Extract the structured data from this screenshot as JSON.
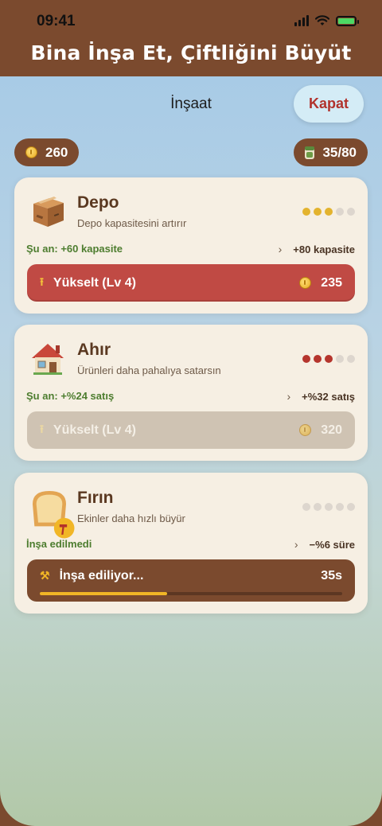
{
  "status": {
    "time": "09:41"
  },
  "app": {
    "title": "Bina İnşa Et, Çiftliğini Büyüt"
  },
  "topbar": {
    "title": "İnşaat",
    "close_label": "Kapat"
  },
  "resources": {
    "coins": "260",
    "storage": "35/80"
  },
  "buildings": [
    {
      "name": "Depo",
      "description": "Depo kapasitesini artırır",
      "current": "Şu an: +60 kapasite",
      "next": "+80 kapasite",
      "level_filled": 3,
      "level_total": 5,
      "dot_color": "#e3b32e",
      "icon": "box-icon",
      "button": {
        "label": "Yükselt (Lv 4)",
        "cost": "235",
        "state": "enabled"
      }
    },
    {
      "name": "Ahır",
      "description": "Ürünleri daha pahalıya satarsın",
      "current": "Şu an: +%24 satış",
      "next": "+%32 satış",
      "level_filled": 3,
      "level_total": 5,
      "dot_color": "#b5352d",
      "icon": "house-icon",
      "button": {
        "label": "Yükselt (Lv 4)",
        "cost": "320",
        "state": "disabled"
      }
    },
    {
      "name": "Fırın",
      "description": "Ekinler daha hızlı büyür",
      "current": "İnşa edilmedi",
      "next": "−%6 süre",
      "level_filled": 0,
      "level_total": 5,
      "dot_color": "#ddd6ce",
      "icon": "bread-icon",
      "button": {
        "label": "İnşa ediliyor...",
        "timer": "35s",
        "progress": 0.42,
        "state": "building"
      }
    }
  ]
}
